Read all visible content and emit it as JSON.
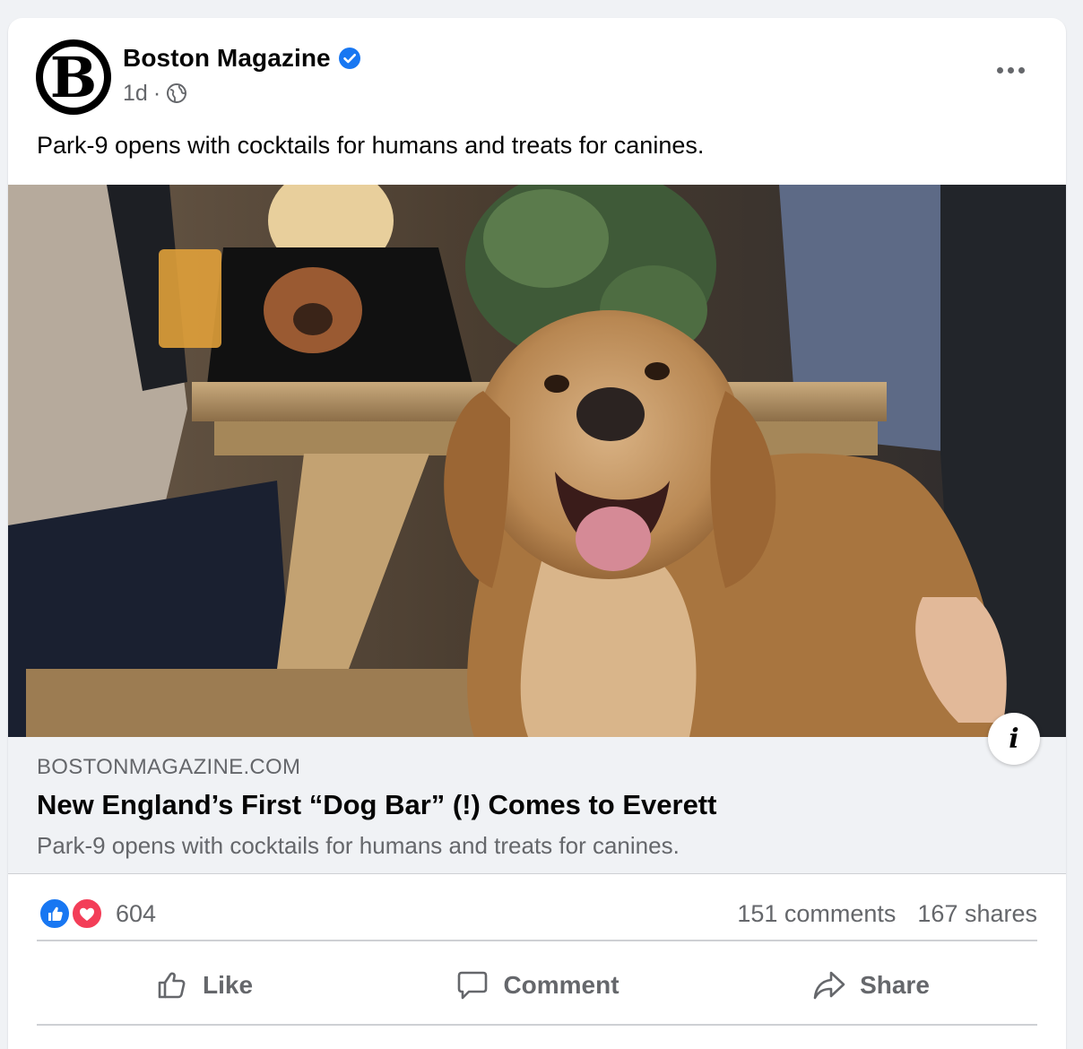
{
  "post": {
    "page_name": "Boston Magazine",
    "avatar_letter": "B",
    "time": "1d",
    "meta_sep": "·",
    "audience_icon": "globe-icon",
    "verified_icon": "verified-badge-icon",
    "text": "Park-9 opens with cocktails for humans and treats for canines."
  },
  "link_preview": {
    "domain": "BOSTONMAGAZINE.COM",
    "title": "New England’s First “Dog Bar” (!) Comes to Everett",
    "description": "Park-9 opens with cocktails for humans and treats for canines."
  },
  "stats": {
    "reaction_icons": [
      "like-reaction-icon",
      "love-reaction-icon"
    ],
    "reaction_count": "604",
    "comments": "151 comments",
    "shares": "167 shares"
  },
  "actions": {
    "like": "Like",
    "comment": "Comment",
    "share": "Share"
  },
  "colors": {
    "brand_blue": "#1877f2",
    "love_red": "#f33e58",
    "secondary_text": "#65676b",
    "background": "#f0f2f5"
  }
}
